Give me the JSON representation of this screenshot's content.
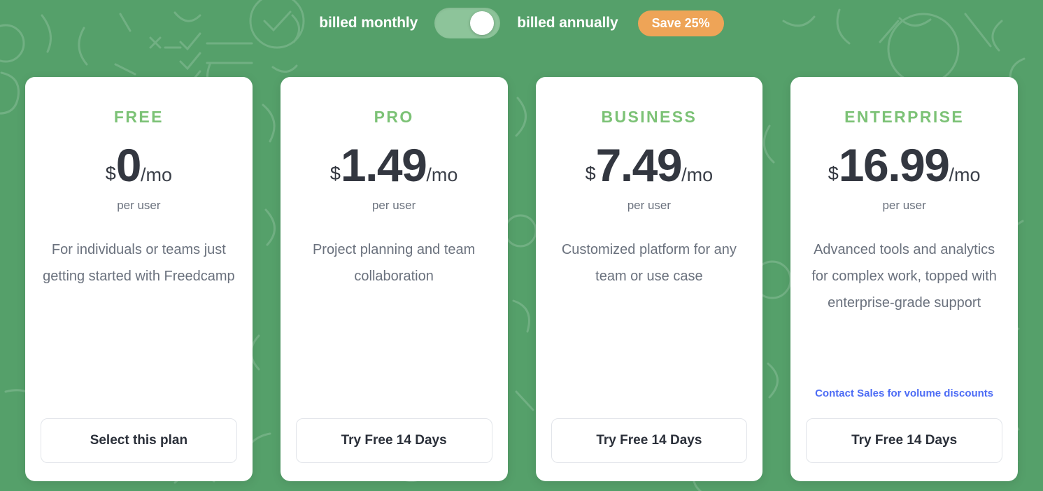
{
  "billing": {
    "monthly_label": "billed monthly",
    "annual_label": "billed annually",
    "save_badge": "Save 25%",
    "toggle_state": "annually"
  },
  "theme": {
    "background_green": "#55a06a",
    "plan_name_green": "#7cc276",
    "badge_orange": "#eea457",
    "link_blue": "#4d6cf5",
    "price_dark": "#333740"
  },
  "plans": [
    {
      "name": "FREE",
      "currency": "$",
      "amount": "0",
      "period": "/mo",
      "per_user": "per user",
      "description": "For individuals or teams just getting started with Freedcamp",
      "contact_link": "",
      "cta": "Select this plan"
    },
    {
      "name": "PRO",
      "currency": "$",
      "amount": "1.49",
      "period": "/mo",
      "per_user": "per user",
      "description": "Project planning and team collaboration",
      "contact_link": "",
      "cta": "Try Free 14 Days"
    },
    {
      "name": "BUSINESS",
      "currency": "$",
      "amount": "7.49",
      "period": "/mo",
      "per_user": "per user",
      "description": "Customized platform for any team or use case",
      "contact_link": "",
      "cta": "Try Free 14 Days"
    },
    {
      "name": "ENTERPRISE",
      "currency": "$",
      "amount": "16.99",
      "period": "/mo",
      "per_user": "per user",
      "description": "Advanced tools and analytics for complex work, topped with enterprise-grade support",
      "contact_link": "Contact Sales for volume discounts",
      "cta": "Try Free 14 Days"
    }
  ]
}
